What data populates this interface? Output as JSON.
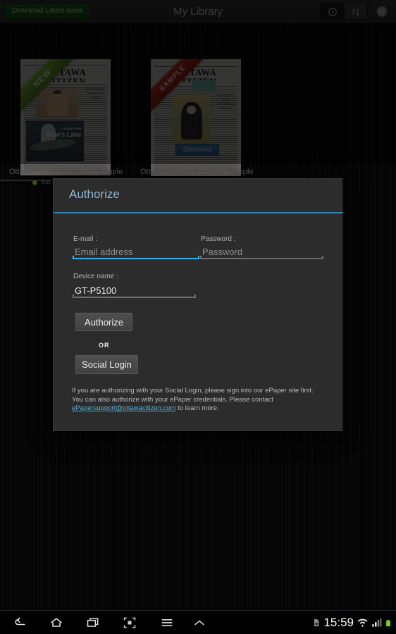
{
  "actionbar": {
    "download_button": "Download Latest Issue",
    "title": "My Library",
    "toggle_recent_icon": "clock-icon",
    "toggle_sort_icon": "sort-icon",
    "settings_icon": "gear-icon"
  },
  "library": {
    "items": [
      {
        "title": "Ottawa Citizen Weekend Sample",
        "ribbon": "NEW",
        "ribbon_color": "#6fae2c",
        "masthead": "OTTAWA CITIZEN",
        "headline": "Dow's Lake",
        "headline_kicker": "IT CAME FROM",
        "side_story": "Decoding the mystery of Dieppe",
        "date": "Sat,",
        "status_dot_color": "#7cc23e"
      },
      {
        "title": "Ottawa Citizen Weekday Sample",
        "ribbon": "SAMPLE",
        "ribbon_color": "#c0392b",
        "masthead": "OTTAWA CITIZEN",
        "side_story": "Funding for Arctic surveillance dries up",
        "download_button": "Download"
      }
    ]
  },
  "dialog": {
    "title": "Authorize",
    "accent_color": "#2b86a8",
    "email": {
      "label": "E-mail :",
      "value": "",
      "placeholder": "Email address",
      "focused": true
    },
    "password": {
      "label": "Password :",
      "value": "",
      "placeholder": "Password",
      "focused": false
    },
    "device": {
      "label": "Device name :",
      "value": "GT-P5100",
      "placeholder": "",
      "focused": false
    },
    "authorize_button": "Authorize",
    "or_label": "OR",
    "social_button": "Social Login",
    "note_part1": "If you are authorizing with your Social Login, please sign into our ePaper site first. You can also authorize with your ePaper credentials. Please contact ",
    "note_link": "ePapersupport@ottawacitizen.com",
    "note_part2": " to learn more."
  },
  "navbar": {
    "back_icon": "back-icon",
    "home_icon": "home-icon",
    "recents_icon": "recent-apps-icon",
    "screenshot_icon": "screenshot-icon",
    "menu_icon": "menu-icon",
    "expand_icon": "chevron-up-icon",
    "sim_icon": "sim-card-icon",
    "clock": "15:59",
    "wifi_icon": "wifi-icon",
    "signal_icon": "signal-icon",
    "battery_icon": "battery-full-icon"
  }
}
